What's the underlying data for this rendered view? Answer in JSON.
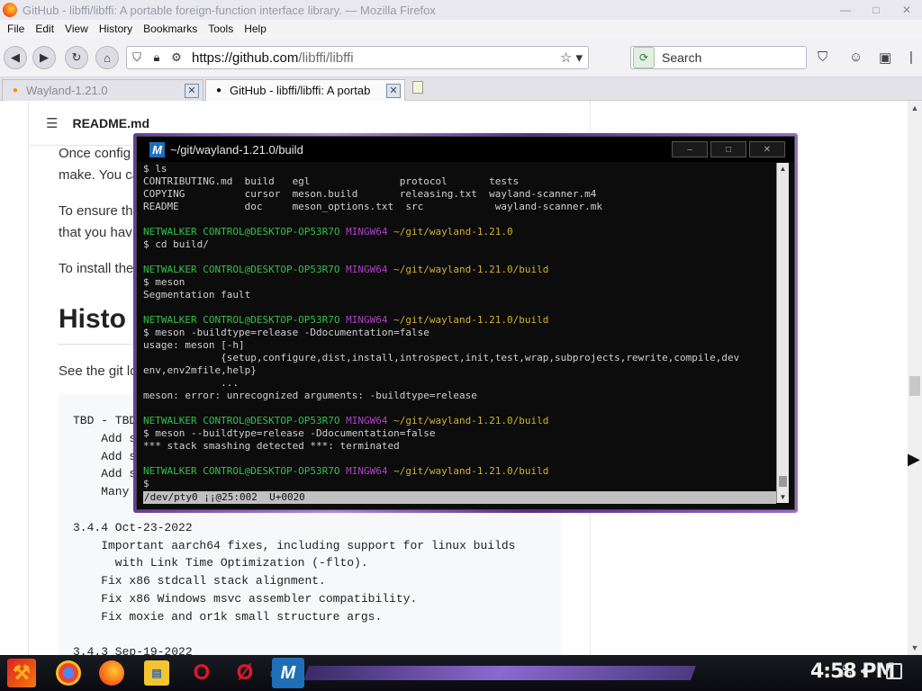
{
  "browser": {
    "window_title": "GitHub - libffi/libffi: A portable foreign-function interface library. — Mozilla Firefox",
    "menu": [
      "File",
      "Edit",
      "View",
      "History",
      "Bookmarks",
      "Tools",
      "Help"
    ],
    "url_host": "https://github.com",
    "url_path": "/libffi/libffi",
    "search_placeholder": "Search",
    "tabs": [
      {
        "title": "Wayland-1.21.0",
        "active": false
      },
      {
        "title": "GitHub - libffi/libffi: A portab",
        "active": true
      }
    ]
  },
  "page": {
    "readme_title": "README.md",
    "paragraphs": [
      [
        "Once config",
        "make. You ca"
      ],
      [
        "To ensure th",
        "that you hav"
      ],
      [
        "To install the"
      ]
    ],
    "history_heading": "Histo",
    "history_intro": "See the git lo",
    "code_lines": [
      "TBD - TBD",
      "    Add s",
      "    Add s",
      "    Add s",
      "    Many ",
      "",
      "3.4.4 Oct-23-2022",
      "    Important aarch64 fixes, including support for linux builds",
      "      with Link Time Optimization (-flto).",
      "    Fix x86 stdcall stack alignment.",
      "    Fix x86 Windows msvc assembler compatibility.",
      "    Fix moxie and or1k small structure args.",
      "",
      "3.4.3 Sep-19-2022"
    ]
  },
  "terminal": {
    "title": "~/git/wayland-1.21.0/build",
    "status_bar": "/dev/pty0 ¡¡@25:002  U+0020",
    "prompt_user": "NETWALKER CONTROL@DESKTOP-OP53R7O",
    "prompt_env": "MINGW64",
    "lines": [
      {
        "t": "cmd",
        "text": "$ ls"
      },
      {
        "t": "out",
        "text": "CONTRIBUTING.md  build   egl               protocol       tests"
      },
      {
        "t": "out",
        "text": "COPYING          cursor  meson.build       releasing.txt  wayland-scanner.m4"
      },
      {
        "t": "out",
        "text": "README           doc     meson_options.txt  src            wayland-scanner.mk"
      },
      {
        "t": "out",
        "text": ""
      },
      {
        "t": "prompt",
        "path": "~/git/wayland-1.21.0"
      },
      {
        "t": "cmd",
        "text": "$ cd build/"
      },
      {
        "t": "out",
        "text": ""
      },
      {
        "t": "prompt",
        "path": "~/git/wayland-1.21.0/build"
      },
      {
        "t": "cmd",
        "text": "$ meson"
      },
      {
        "t": "out",
        "text": "Segmentation fault"
      },
      {
        "t": "out",
        "text": ""
      },
      {
        "t": "prompt",
        "path": "~/git/wayland-1.21.0/build"
      },
      {
        "t": "cmd",
        "text": "$ meson -buildtype=release -Ddocumentation=false"
      },
      {
        "t": "out",
        "text": "usage: meson [-h]"
      },
      {
        "t": "out",
        "text": "             {setup,configure,dist,install,introspect,init,test,wrap,subprojects,rewrite,compile,dev"
      },
      {
        "t": "out",
        "text": "env,env2mfile,help}"
      },
      {
        "t": "out",
        "text": "             ..."
      },
      {
        "t": "out",
        "text": "meson: error: unrecognized arguments: -buildtype=release"
      },
      {
        "t": "out",
        "text": ""
      },
      {
        "t": "prompt",
        "path": "~/git/wayland-1.21.0/build"
      },
      {
        "t": "cmd",
        "text": "$ meson --buildtype=release -Ddocumentation=false"
      },
      {
        "t": "out",
        "text": "*** stack smashing detected ***: terminated"
      },
      {
        "t": "out",
        "text": ""
      },
      {
        "t": "prompt",
        "path": "~/git/wayland-1.21.0/build"
      },
      {
        "t": "cmd",
        "text": "$"
      }
    ]
  },
  "taskbar": {
    "clock": "4:58 PM",
    "apps": [
      "chrome-icon",
      "firefox-icon",
      "file-explorer-icon",
      "opera-icon",
      "opera-gx-icon",
      "media-icon",
      "mintty-icon"
    ]
  }
}
